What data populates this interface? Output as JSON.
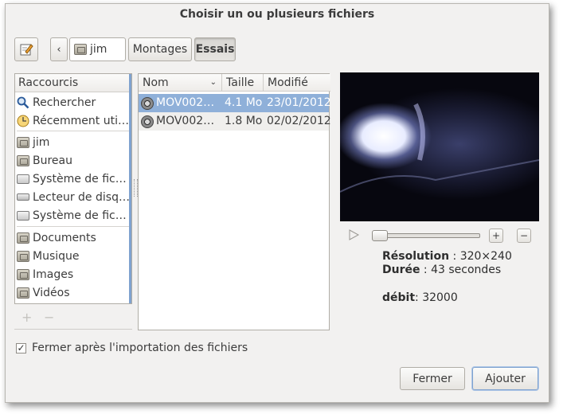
{
  "window": {
    "title": "Choisir un ou plusieurs fichiers"
  },
  "toolbar": {
    "edit_icon": "pencil-edit-icon",
    "back_icon": "chevron-left-icon",
    "path": [
      {
        "label": "jim",
        "icon": "home-folder-icon"
      },
      {
        "label": "Montages"
      },
      {
        "label": "Essais",
        "active": true
      }
    ]
  },
  "sidebar": {
    "header": "Raccourcis",
    "items": [
      {
        "label": "Rechercher",
        "icon": "search-icon"
      },
      {
        "label": "Récemment uti…",
        "icon": "clock-icon"
      },
      {
        "label": "jim",
        "icon": "home-folder-icon"
      },
      {
        "label": "Bureau",
        "icon": "desktop-folder-icon"
      },
      {
        "label": "Système de fic…",
        "icon": "drive-icon"
      },
      {
        "label": "Lecteur de disq…",
        "icon": "floppy-drive-icon"
      },
      {
        "label": "Système de fic…",
        "icon": "drive-icon"
      },
      {
        "label": "Documents",
        "icon": "documents-folder-icon"
      },
      {
        "label": "Musique",
        "icon": "music-folder-icon"
      },
      {
        "label": "Images",
        "icon": "pictures-folder-icon"
      },
      {
        "label": "Vidéos",
        "icon": "videos-folder-icon"
      }
    ],
    "add": "+",
    "remove": "−"
  },
  "files": {
    "columns": [
      "Nom",
      "Taille",
      "Modifié"
    ],
    "sort_icon": "chevron-down-icon",
    "rows": [
      {
        "name": "MOV002…",
        "size": "4.1 Mo",
        "date": "23/01/2012",
        "selected": true
      },
      {
        "name": "MOV002…",
        "size": "1.8 Mo",
        "date": "02/02/2012",
        "selected": false
      }
    ]
  },
  "preview": {
    "play_icon": "play-icon",
    "zoom_in_icon": "zoom-in-icon",
    "zoom_out_icon": "zoom-out-icon",
    "position": 0,
    "resolution_label": "Résolution",
    "resolution_value": " : 320×240",
    "duration_label": "Durée",
    "duration_value": " : 43 secondes",
    "bitrate_label": "débit",
    "bitrate_value": ": 32000"
  },
  "options": {
    "close_after_import": "Fermer après l'importation des fichiers",
    "checked": true
  },
  "buttons": {
    "close": "Fermer",
    "add": "Ajouter"
  }
}
